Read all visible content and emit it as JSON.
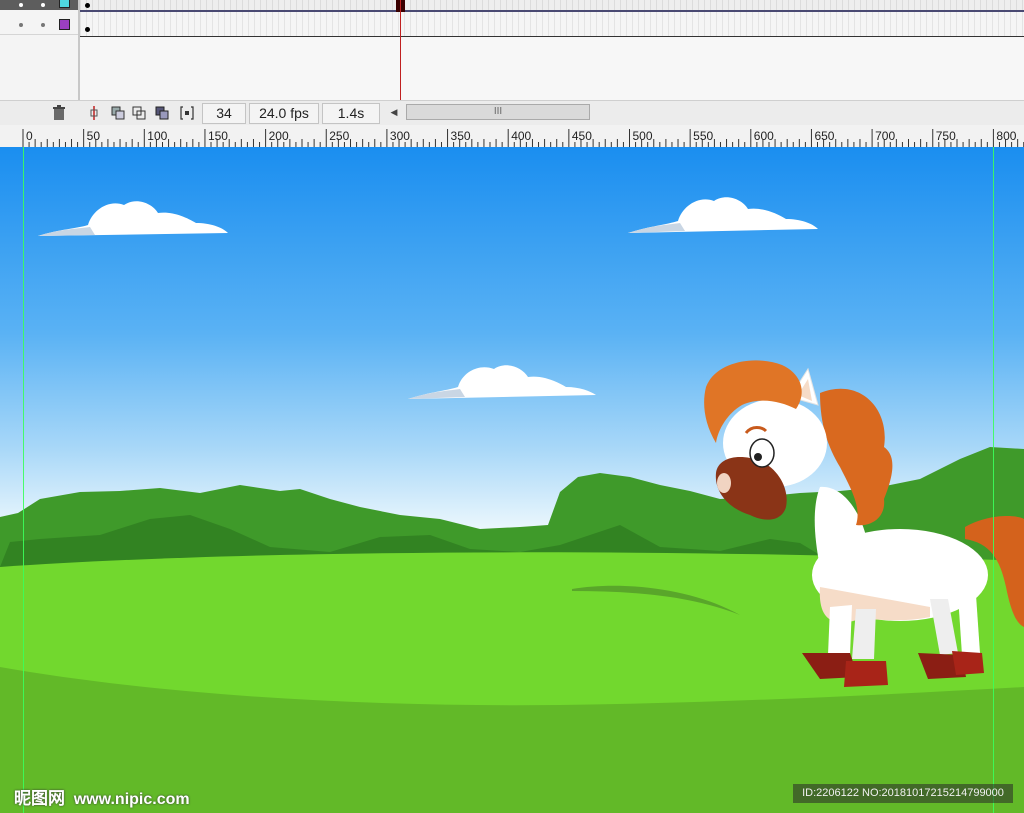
{
  "timeline": {
    "current_frame": "34",
    "fps": "24.0 fps",
    "elapsed": "1.4s",
    "layer_colors": [
      "#4fd8e0",
      "#9b3fc2"
    ],
    "icons": [
      "trash-icon",
      "center-frame-icon",
      "onion-skin-icon",
      "onion-skin-outlines-icon",
      "edit-multiple-frames-icon",
      "modify-onion-markers-icon"
    ],
    "scroll_grip": "III",
    "scroll_left_arrow": "◀"
  },
  "ruler": {
    "labels": [
      "0",
      "50",
      "100",
      "150",
      "200",
      "250",
      "300",
      "350",
      "400",
      "450",
      "500",
      "550",
      "600",
      "650",
      "700",
      "750",
      "800"
    ]
  },
  "watermark": {
    "site_logo": "昵图网",
    "site_url": "www.nipic.com",
    "id_text": "ID:2206122 NO:20181017215214799000"
  },
  "colors": {
    "guide": "#3bff5a",
    "sky_top": "#1a8ef0",
    "grass": "#72d82e",
    "trees": "#3f9a2a"
  }
}
